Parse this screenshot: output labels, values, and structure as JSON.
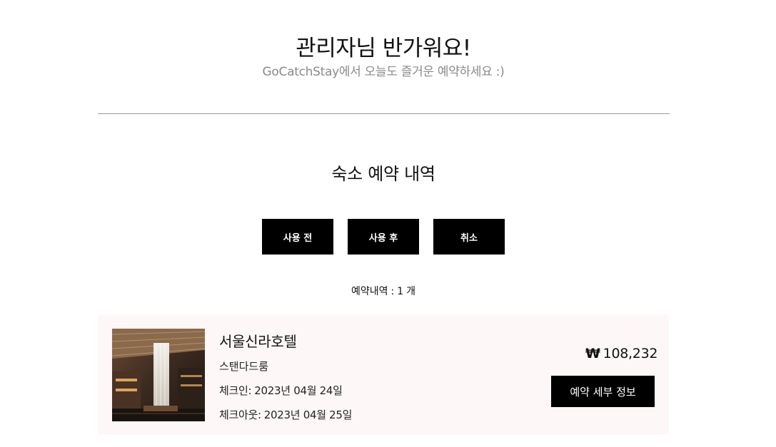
{
  "greeting": {
    "title": "관리자님 반가워요!",
    "subtitle": "GoCatchStay에서 오늘도 즐거운 예약하세요 :)"
  },
  "section": {
    "title": "숙소 예약 내역"
  },
  "filters": {
    "before_label": "사용 전",
    "after_label": "사용 후",
    "cancel_label": "취소"
  },
  "summary": {
    "label": "예약내역",
    "separator": ":",
    "count": "1",
    "unit": "개"
  },
  "reservations": [
    {
      "hotel_name": "서울신라호텔",
      "room_type": "스탠다드룸",
      "checkin_label": "체크인:",
      "checkin_date": "2023년 04월 24일",
      "checkout_label": "체크아웃:",
      "checkout_date": "2023년 04월 25일",
      "currency_symbol": "₩",
      "price": "108,232",
      "detail_button_label": "예약 세부 정보",
      "thumbnail_icon": "hotel-lobby-photo"
    }
  ],
  "colors": {
    "button_bg": "#000000",
    "button_text": "#ffffff",
    "card_bg": "#fdf8f7",
    "subtitle": "#8a8a8a",
    "divider": "#9a9a9a"
  }
}
